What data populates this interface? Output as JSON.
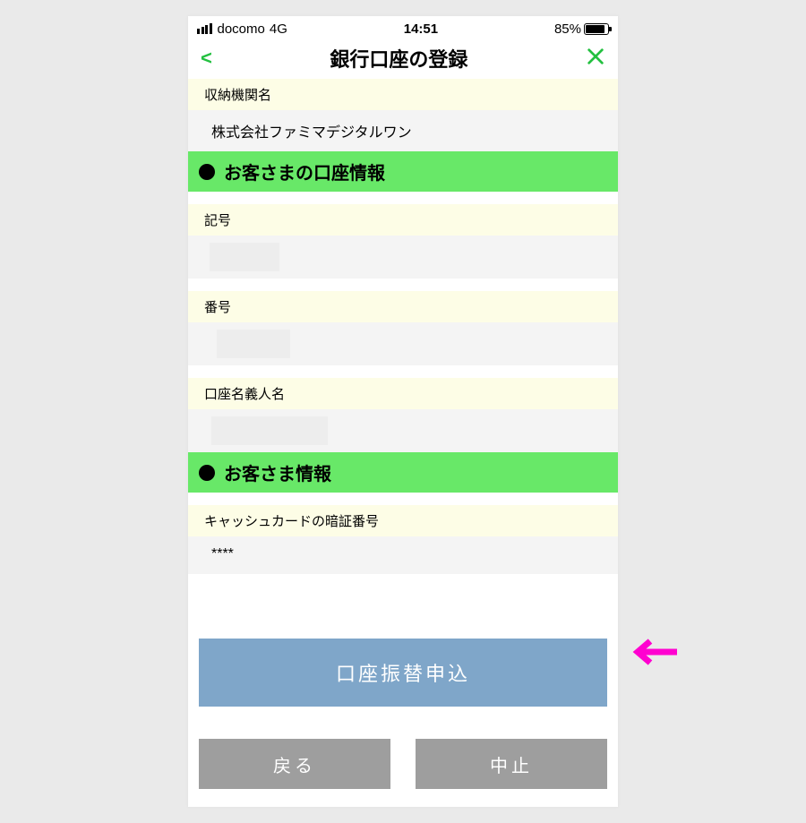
{
  "status": {
    "carrier": "docomo",
    "network": "4G",
    "time": "14:51",
    "battery_pct": "85%"
  },
  "header": {
    "back": "<",
    "title": "銀行口座の登録"
  },
  "org": {
    "label": "収納機関名",
    "value": "株式会社ファミマデジタルワン"
  },
  "section1": {
    "title": "お客さまの口座情報"
  },
  "kigo": {
    "label": "記号"
  },
  "bango": {
    "label": "番号"
  },
  "holder": {
    "label": "口座名義人名"
  },
  "section2": {
    "title": "お客さま情報"
  },
  "pin": {
    "label": "キャッシュカードの暗証番号",
    "value": "****"
  },
  "buttons": {
    "primary": "口座振替申込",
    "back": "戻る",
    "cancel": "中止"
  }
}
